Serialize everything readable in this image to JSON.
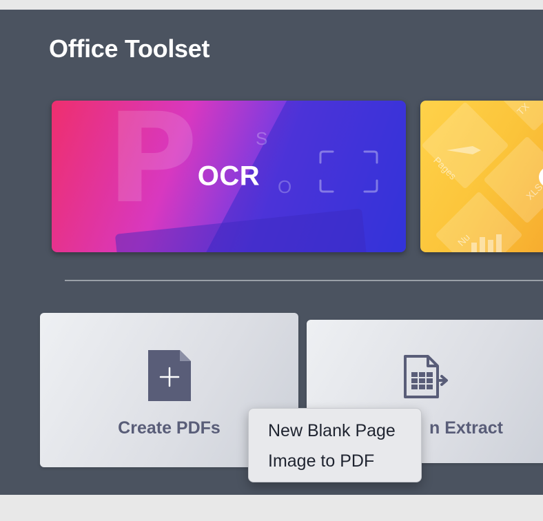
{
  "app": {
    "title": "Office Toolset"
  },
  "feature_cards": [
    {
      "label": "OCR",
      "icon": "scan-frame-icon",
      "accent": "#3b3de8"
    },
    {
      "label": "",
      "icon": "file-formats-pattern",
      "accent": "#fbc43a",
      "decor_text": [
        "TX",
        "Pages",
        "XLS",
        "Nu"
      ]
    }
  ],
  "tools": [
    {
      "label": "Create PDFs",
      "icon": "document-plus-icon"
    },
    {
      "label": "n Extract",
      "icon": "table-export-icon"
    }
  ],
  "context_menu": {
    "items": [
      "New Blank Page",
      "Image to PDF"
    ]
  },
  "colors": {
    "panel_bg": "#4b5360",
    "tool_label": "#595d78",
    "icon_fill": "#595d78"
  }
}
